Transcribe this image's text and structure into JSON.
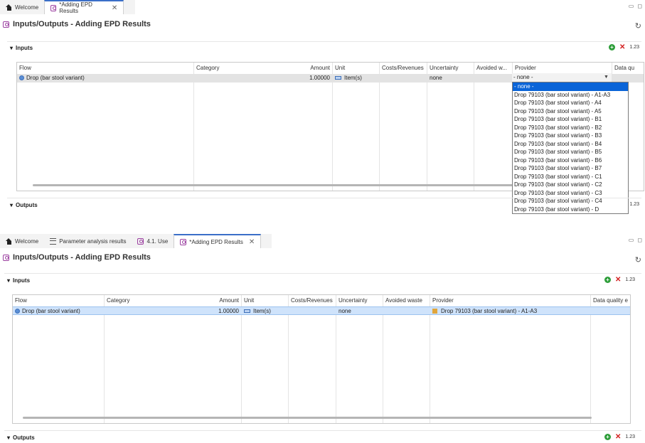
{
  "top": {
    "tabs": [
      {
        "label": "Welcome",
        "icon": "home-icon"
      },
      {
        "label": "*Adding EPD Results",
        "icon": "process-icon",
        "active": true
      }
    ],
    "title": "Inputs/Outputs - Adding EPD Results",
    "inputs_label": "Inputs",
    "outputs_label": "Outputs",
    "columns": [
      "Flow",
      "Category",
      "Amount",
      "Unit",
      "Costs/Revenues",
      "Uncertainty",
      "Avoided w...",
      "Provider",
      "Data qu"
    ],
    "row": {
      "flow": "Drop (bar stool variant)",
      "category": "",
      "amount": "1.00000",
      "unit": "Item(s)",
      "costs": "",
      "uncertainty": "none",
      "avoided": "",
      "provider": "- none -"
    },
    "dropdown_options": [
      "- none -",
      "Drop 79103 (bar stool variant) - A1-A3",
      "Drop 79103 (bar stool variant) - A4",
      "Drop 79103 (bar stool variant) - A5",
      "Drop 79103 (bar stool variant) - B1",
      "Drop 79103 (bar stool variant) - B2",
      "Drop 79103 (bar stool variant) - B3",
      "Drop 79103 (bar stool variant) - B4",
      "Drop 79103 (bar stool variant) - B5",
      "Drop 79103 (bar stool variant) - B6",
      "Drop 79103 (bar stool variant) - B7",
      "Drop 79103 (bar stool variant) - C1",
      "Drop 79103 (bar stool variant) - C2",
      "Drop 79103 (bar stool variant) - C3",
      "Drop 79103 (bar stool variant) - C4",
      "Drop 79103 (bar stool variant) - D"
    ],
    "selected_option": "- none -"
  },
  "bottom": {
    "tabs": [
      {
        "label": "Welcome",
        "icon": "home-icon"
      },
      {
        "label": "Parameter analysis results",
        "icon": "list-icon"
      },
      {
        "label": "4.1. Use",
        "icon": "process-icon"
      },
      {
        "label": "*Adding EPD Results",
        "icon": "process-icon",
        "active": true
      }
    ],
    "title": "Inputs/Outputs - Adding EPD Results",
    "inputs_label": "Inputs",
    "outputs_label": "Outputs",
    "columns": [
      "Flow",
      "Category",
      "Amount",
      "Unit",
      "Costs/Revenues",
      "Uncertainty",
      "Avoided waste",
      "Provider",
      "Data quality e"
    ],
    "row": {
      "flow": "Drop (bar stool variant)",
      "category": "",
      "amount": "1.00000",
      "unit": "Item(s)",
      "costs": "",
      "uncertainty": "none",
      "avoided": "",
      "provider": "Drop 79103 (bar stool variant) - A1-A3"
    }
  },
  "tools_text": "1.23",
  "close_glyph": "✕",
  "colors": {
    "accent": "#3b6fc8",
    "selection": "#0a64d8",
    "row_highlight": "#cfe3fb",
    "add": "#2e9e3a",
    "delete": "#d32020"
  }
}
